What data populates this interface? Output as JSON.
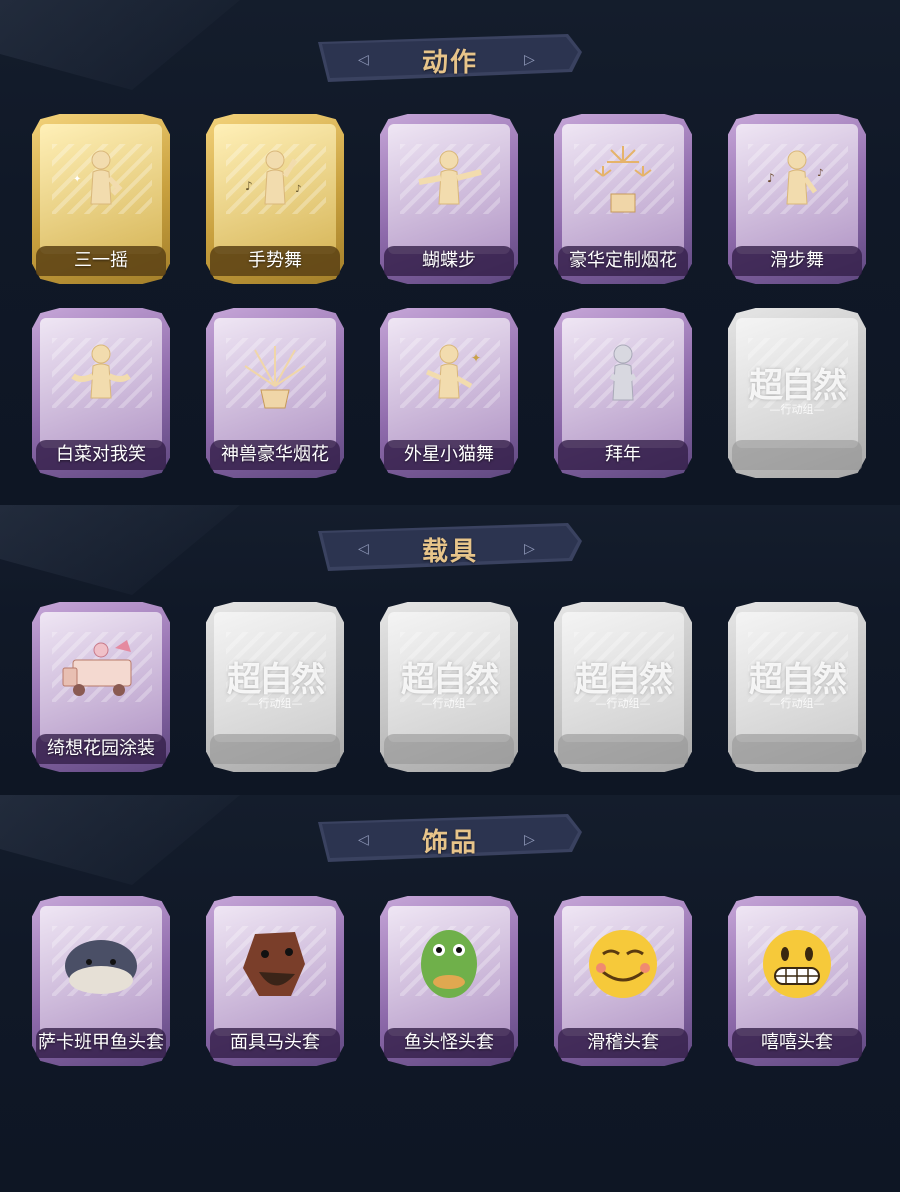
{
  "colors": {
    "background": "#0e1624",
    "banner": "#3a4260",
    "banner_title": "#e7c48a",
    "gold_card": "#d8b553",
    "purple_card": "#a17fbf",
    "locked_card": "#c8c8c8"
  },
  "sections": [
    {
      "title": "动作",
      "items": [
        {
          "label": "三一摇",
          "rarity": "gold",
          "icon": "figure-pose-icon"
        },
        {
          "label": "手势舞",
          "rarity": "gold",
          "icon": "figure-dance-icon"
        },
        {
          "label": "蝴蝶步",
          "rarity": "purple",
          "icon": "figure-arms-out-icon"
        },
        {
          "label": "豪华定制烟花",
          "rarity": "purple",
          "icon": "fireworks-box-icon"
        },
        {
          "label": "滑步舞",
          "rarity": "purple",
          "icon": "figure-slide-icon"
        },
        {
          "label": "白菜对我笑",
          "rarity": "purple",
          "icon": "figure-arms-wide-icon"
        },
        {
          "label": "神兽豪华烟花",
          "rarity": "purple",
          "icon": "fireworks-pot-icon"
        },
        {
          "label": "外星小猫舞",
          "rarity": "purple",
          "icon": "figure-cat-dance-icon"
        },
        {
          "label": "拜年",
          "rarity": "purple",
          "icon": "figure-bow-icon"
        },
        {
          "label": "",
          "rarity": "locked",
          "icon": "locked-logo"
        }
      ]
    },
    {
      "title": "载具",
      "items": [
        {
          "label": "绮想花园涂装",
          "rarity": "purple",
          "icon": "truck-icon"
        },
        {
          "label": "",
          "rarity": "locked",
          "icon": "locked-logo"
        },
        {
          "label": "",
          "rarity": "locked",
          "icon": "locked-logo"
        },
        {
          "label": "",
          "rarity": "locked",
          "icon": "locked-logo"
        },
        {
          "label": "",
          "rarity": "locked",
          "icon": "locked-logo"
        }
      ]
    },
    {
      "title": "饰品",
      "items": [
        {
          "label": "萨卡班甲鱼头套",
          "rarity": "purple",
          "icon": "fish-head-mask-icon"
        },
        {
          "label": "面具马头套",
          "rarity": "purple",
          "icon": "horse-mask-icon"
        },
        {
          "label": "鱼头怪头套",
          "rarity": "purple",
          "icon": "fish-monster-mask-icon"
        },
        {
          "label": "滑稽头套",
          "rarity": "purple",
          "icon": "funny-face-mask-icon"
        },
        {
          "label": "嘻嘻头套",
          "rarity": "purple",
          "icon": "grin-face-mask-icon"
        }
      ]
    }
  ],
  "locked_logo": {
    "main": "超自然",
    "sub": "—行动组—"
  }
}
